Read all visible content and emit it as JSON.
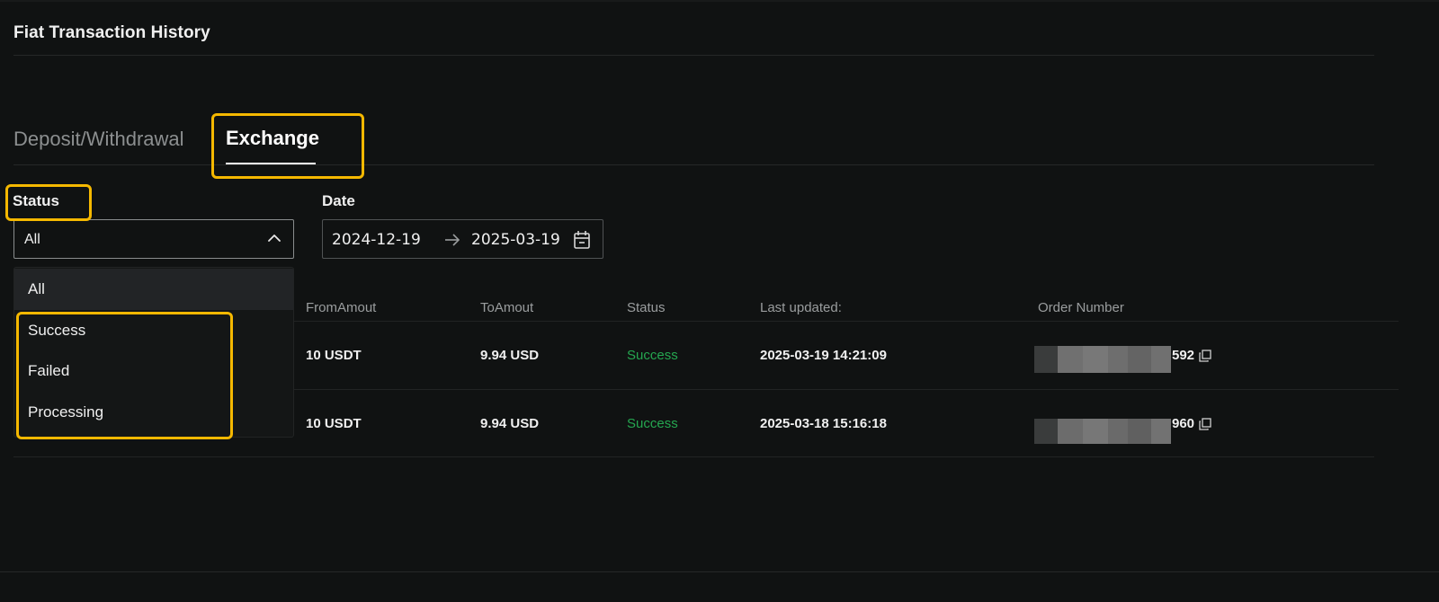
{
  "page": {
    "title": "Fiat Transaction History"
  },
  "tabs": [
    {
      "label": "Deposit/Withdrawal",
      "active": false
    },
    {
      "label": "Exchange",
      "active": true
    }
  ],
  "filters": {
    "status_label": "Status",
    "status_value": "All",
    "date_label": "Date",
    "date_start": "2024-12-19",
    "date_end": "2025-03-19"
  },
  "status_options": [
    "All",
    "Success",
    "Failed",
    "Processing"
  ],
  "table": {
    "headers": [
      "FromAmout",
      "ToAmout",
      "Status",
      "Last updated:",
      "Order Number"
    ],
    "rows": [
      {
        "from": "10 USDT",
        "to": "9.94 USD",
        "status": "Success",
        "updated": "2025-03-19 14:21:09",
        "order_suffix": "592"
      },
      {
        "from": "10 USDT",
        "to": "9.94 USD",
        "status": "Success",
        "updated": "2025-03-18 15:16:18",
        "order_suffix": "960"
      }
    ]
  },
  "colors": {
    "background": "#101212",
    "highlight": "#f5b800",
    "success": "#25a750"
  },
  "icons": [
    "chevron-up-icon",
    "arrow-right-icon",
    "calendar-icon",
    "copy-icon"
  ]
}
